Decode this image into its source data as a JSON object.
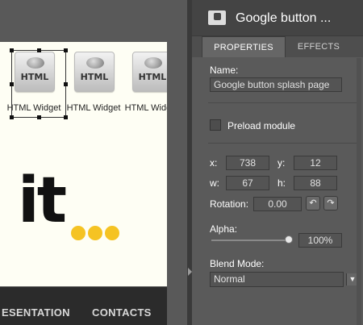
{
  "canvas": {
    "widgets": [
      {
        "tag": "HTML",
        "caption": "HTML Widget"
      },
      {
        "tag": "HTML",
        "caption": "HTML Widget"
      },
      {
        "tag": "HTML",
        "caption": "HTML Widget"
      }
    ],
    "logo_text": "it",
    "nav_items": [
      "ESENTATION",
      "CONTACTS"
    ]
  },
  "panel": {
    "title": "Google button ...",
    "tabs": [
      "PROPERTIES",
      "EFFECTS"
    ],
    "name_label": "Name:",
    "name_value": "Google button splash page",
    "preload_label": "Preload module",
    "preload_checked": false,
    "x_label": "x:",
    "x_value": "738",
    "y_label": "y:",
    "y_value": "12",
    "w_label": "w:",
    "w_value": "67",
    "h_label": "h:",
    "h_value": "88",
    "rotation_label": "Rotation:",
    "rotation_value": "0.00",
    "alpha_label": "Alpha:",
    "alpha_value": "100%",
    "alpha_level": 1.0,
    "blend_label": "Blend Mode:",
    "blend_value": "Normal"
  },
  "colors": {
    "accent_dots": "#f5c323",
    "panel_bg": "#5a5a5a",
    "header_bg": "#444444"
  }
}
